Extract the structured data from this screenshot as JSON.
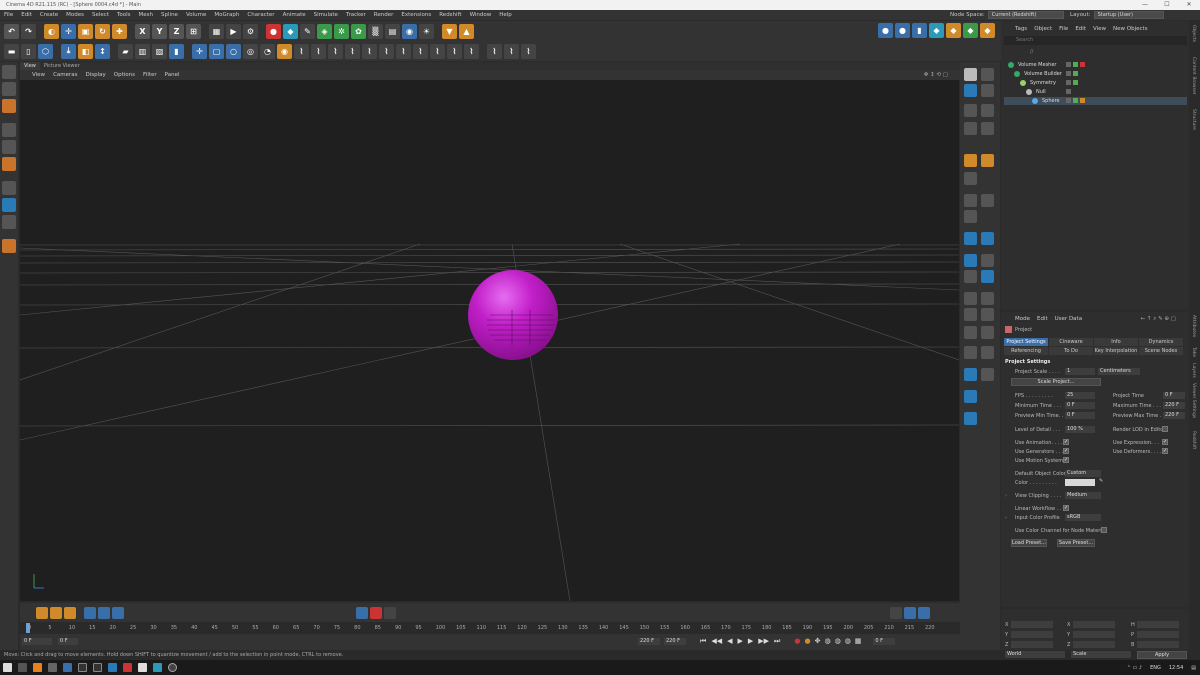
{
  "window": {
    "title": "Cinema 4D R21.115 (RC) - [Sphere 0004.c4d *] - Main",
    "controls": [
      "—",
      "☐",
      "✕"
    ]
  },
  "menubar": {
    "items": [
      "File",
      "Edit",
      "Create",
      "Modes",
      "Select",
      "Tools",
      "Mesh",
      "Spline",
      "Volume",
      "MoGraph",
      "Character",
      "Animate",
      "Simulate",
      "Tracker",
      "Render",
      "Extensions",
      "Redshift",
      "Window",
      "Help"
    ],
    "node_space_label": "Node Space:",
    "node_space_value": "Current (Redshift)",
    "layout_label": "Layout:",
    "layout_value": "Startup (User)"
  },
  "viewport": {
    "tabs": [
      "View",
      "Picture Viewer"
    ],
    "menu": [
      "View",
      "Cameras",
      "Display",
      "Options",
      "Filter",
      "Panel"
    ],
    "sphere_color": "#c21fc9",
    "grid_color": "#5a5a5a"
  },
  "objects": {
    "menu": [
      "Tags",
      "Object",
      "File",
      "Edit",
      "View",
      "New Objects"
    ],
    "search_placeholder": "Search",
    "path": "//",
    "items": [
      {
        "name": "Volume Mesher",
        "color": "#36a86a"
      },
      {
        "name": "Volume Builder",
        "color": "#36a86a"
      },
      {
        "name": "Symmetry",
        "color": "#9cd06a"
      },
      {
        "name": "Null",
        "color": "#bbbbbb"
      },
      {
        "name": "Sphere",
        "color": "#5aa6e6"
      }
    ]
  },
  "attributes": {
    "menu": [
      "Mode",
      "Edit",
      "User Data"
    ],
    "object_name": "Project",
    "tabs_row1": [
      "Project Settings",
      "Cineware",
      "Info",
      "Dynamics"
    ],
    "tabs_row2": [
      "Referencing",
      "To Do",
      "Key Interpolation",
      "Scene Nodes"
    ],
    "section": "Project Settings",
    "project_scale_label": "Project Scale . . . .",
    "project_scale_value": "1",
    "project_scale_unit": "Centimeters",
    "scale_project_btn": "Scale Project...",
    "fps_label": "FPS . . . . . . . . .",
    "fps_value": "25",
    "project_time_label": "Project Time",
    "project_time_value": "0 F",
    "min_time_label": "Minimum Time . . .",
    "min_time_value": "0 F",
    "max_time_label": "Maximum Time . . .",
    "max_time_value": "220 F",
    "prev_min_label": "Preview Min Time. .",
    "prev_min_value": "0 F",
    "prev_max_label": "Preview Max Time . .",
    "prev_max_value": "220 F",
    "lod_label": "Level of Detail . . .",
    "lod_value": "100 %",
    "render_lod_label": "Render LOD in Editor",
    "use_animation_label": "Use Animation. . . .",
    "use_expression_label": "Use Expression. . .",
    "use_generators_label": "Use Generators . . .",
    "use_deformers_label": "Use Deformers. . . .",
    "use_motion_label": "Use Motion System",
    "default_color_label": "Default Object Color",
    "default_color_value": "Custom",
    "color_label": "Color . . . . . . . . .",
    "view_clipping_label": "View Clipping . . . .",
    "view_clipping_value": "Medium",
    "linear_workflow_label": "Linear Workflow . .",
    "input_profile_label": "Input Color Profile",
    "input_profile_value": "sRGB",
    "node_material_label": "Use Color Channel for Node Material",
    "load_preset_btn": "Load Preset...",
    "save_preset_btn": "Save Preset...",
    "check": "✓"
  },
  "timeline": {
    "ticks": [
      "0",
      "5",
      "10",
      "15",
      "20",
      "25",
      "30",
      "35",
      "40",
      "45",
      "50",
      "55",
      "60",
      "65",
      "70",
      "75",
      "80",
      "85",
      "90",
      "95",
      "100",
      "105",
      "110",
      "115",
      "120",
      "125",
      "130",
      "135",
      "140",
      "145",
      "150",
      "155",
      "160",
      "165",
      "170",
      "175",
      "180",
      "185",
      "190",
      "195",
      "200",
      "205",
      "210",
      "215",
      "220"
    ],
    "current_frame": "0 F",
    "start_field": "0 F",
    "end_field": "220 F",
    "end_field2": "220 F",
    "frame_right": "0 F"
  },
  "coords": {
    "labels": [
      "X",
      "Y",
      "Z"
    ],
    "right_labels": [
      "H",
      "P",
      "B"
    ],
    "world": "World",
    "scale": "Scale",
    "apply": "Apply"
  },
  "vertical_tabs": [
    "Objects",
    "Content Browser",
    "Structure",
    "Attributes",
    "Take",
    "Layers",
    "Viewer Settings",
    "Redshift"
  ],
  "status": "Move: Click and drag to move elements. Hold down SHIFT to quantize movement / add to the selection in point mode, CTRL to remove.",
  "taskbar": {
    "lang": "ENG",
    "time": "12:54"
  }
}
